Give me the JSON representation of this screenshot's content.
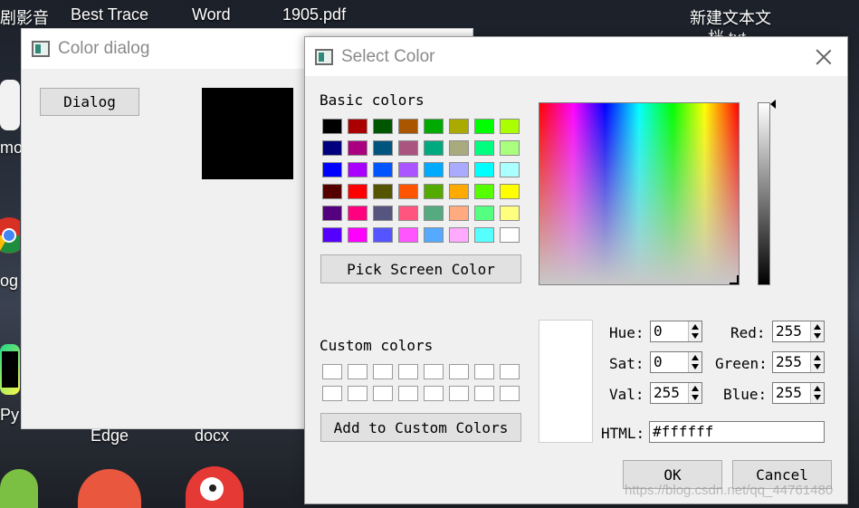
{
  "desktop": {
    "labels": {
      "media": "剧影音",
      "best_trace": "Best Trace",
      "word": "Word",
      "pdf": "1905.pdf",
      "new_text": "新建文本文",
      "new_text2": "档.txt",
      "mo": "mo",
      "og": "og",
      "py": "Py",
      "edge": "Edge",
      "docx": "docx"
    }
  },
  "color_dialog_window": {
    "title": "Color dialog",
    "dialog_button": "Dialog",
    "color_preview": "#000000"
  },
  "select_color_window": {
    "title": "Select Color",
    "basic_colors_label": "Basic colors",
    "basic_colors": [
      [
        "#000000",
        "#aa0000",
        "#005500",
        "#aa5500",
        "#00aa00",
        "#aaaa00",
        "#00ff00",
        "#aaff00"
      ],
      [
        "#00007f",
        "#aa007f",
        "#00557f",
        "#aa557f",
        "#00aa7f",
        "#aaaa7f",
        "#00ff7f",
        "#aaff7f"
      ],
      [
        "#0000ff",
        "#aa00ff",
        "#0055ff",
        "#aa55ff",
        "#00aaff",
        "#aaaaff",
        "#00ffff",
        "#aaffff"
      ],
      [
        "#550000",
        "#ff0000",
        "#555500",
        "#ff5500",
        "#55aa00",
        "#ffaa00",
        "#55ff00",
        "#ffff00"
      ],
      [
        "#55007f",
        "#ff007f",
        "#55557f",
        "#ff557f",
        "#55aa7f",
        "#ffaa7f",
        "#55ff7f",
        "#ffff7f"
      ],
      [
        "#5500ff",
        "#ff00ff",
        "#5555ff",
        "#ff55ff",
        "#55aaff",
        "#ffaaff",
        "#55ffff",
        "#ffffff"
      ]
    ],
    "pick_screen_color": "Pick Screen Color",
    "custom_colors_label": "Custom colors",
    "add_custom_colors": "Add to Custom Colors",
    "fields": {
      "hue_label": "Hue:",
      "hue": "0",
      "sat_label": "Sat:",
      "sat": "0",
      "val_label": "Val:",
      "val": "255",
      "red_label": "Red:",
      "red": "255",
      "green_label": "Green:",
      "green": "255",
      "blue_label": "Blue:",
      "blue": "255",
      "html_label": "HTML:",
      "html": "#ffffff"
    },
    "current_color": "#ffffff",
    "ok": "OK",
    "cancel": "Cancel"
  },
  "watermark": "https://blog.csdn.net/qq_44761480"
}
